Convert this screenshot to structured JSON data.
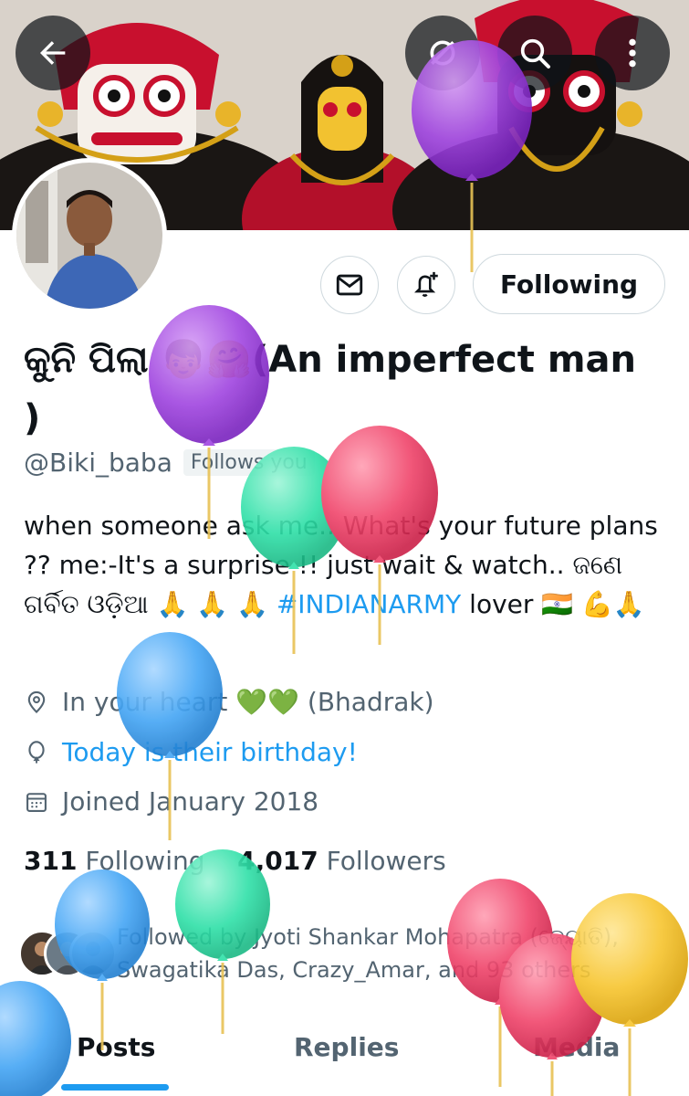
{
  "header": {
    "back_icon": "arrow-left-icon",
    "grok_icon": "grok-icon",
    "search_icon": "search-icon",
    "more_icon": "more-vertical-icon"
  },
  "profile": {
    "display_name": "କୁନି ପିଲା 👦🤗(An imperfect man )",
    "handle": "@Biki_baba",
    "follows_you": "Follows you",
    "bio_text": "when someone ask me.. What's your future plans ?? me:-It's a surprise !! just wait & watch.. ଜଣେ ଗର୍ବିତ ଓଡ଼ିଆ 🙏 🙏 🙏 ",
    "bio_hashtag": "#INDIANARMY",
    "bio_tail": " lover 🇮🇳 💪🙏",
    "location": "In your heart 💚💚 (Bhadrak)",
    "birthday": "Today is their birthday!",
    "joined": "Joined January 2018"
  },
  "actions": {
    "message_icon": "envelope-icon",
    "notify_icon": "bell-plus-icon",
    "follow_label": "Following"
  },
  "stats": {
    "following_count": "311",
    "following_label": "Following",
    "followers_count": "4,017",
    "followers_label": "Followers"
  },
  "followed_by": "Followed by Jyoti Shankar Mohapatra (ଜ୍ୟୋତି), Swagatika Das, Crazy_Amar, and 93 others",
  "tabs": [
    "Posts",
    "Replies",
    "Media"
  ],
  "colors": {
    "accent": "#1d9bf0",
    "text_primary": "#0f1419",
    "text_secondary": "#536471",
    "balloon_purple": "#a045e0",
    "balloon_teal": "#2fe0a8",
    "balloon_red": "#f0456b",
    "balloon_blue": "#45a6f5",
    "balloon_yellow": "#f7c52f"
  }
}
